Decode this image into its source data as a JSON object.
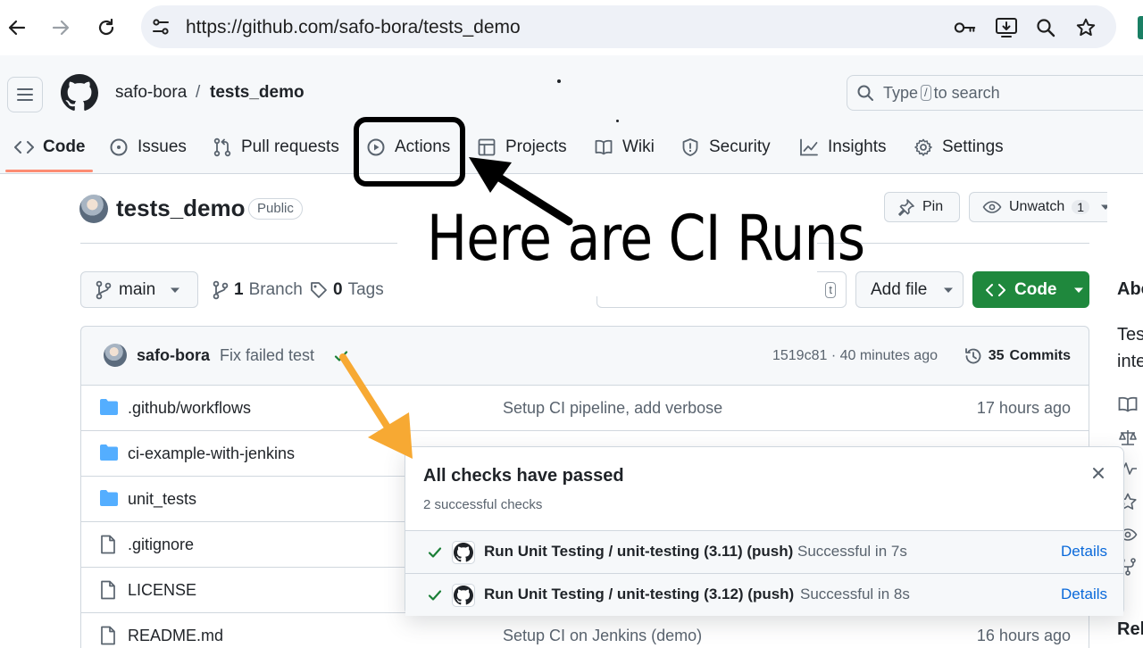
{
  "browser": {
    "url": "https://github.com/safo-bora/tests_demo",
    "icons": [
      "back-arrow-icon",
      "forward-arrow-icon",
      "reload-icon",
      "site-settings-icon",
      "key-icon",
      "install-app-icon",
      "zoom-icon",
      "bookmark-star-icon"
    ]
  },
  "header": {
    "owner": "safo-bora",
    "separator": "/",
    "repo": "tests_demo",
    "search_prefix": "Type",
    "search_key": "/",
    "search_suffix": "to search"
  },
  "tabs": [
    {
      "label": "Code",
      "icon": "code-icon",
      "active": true
    },
    {
      "label": "Issues",
      "icon": "issue-circle-icon"
    },
    {
      "label": "Pull requests",
      "icon": "pull-request-icon"
    },
    {
      "label": "Actions",
      "icon": "play-icon"
    },
    {
      "label": "Projects",
      "icon": "table-icon"
    },
    {
      "label": "Wiki",
      "icon": "book-icon"
    },
    {
      "label": "Security",
      "icon": "shield-icon"
    },
    {
      "label": "Insights",
      "icon": "graph-icon"
    },
    {
      "label": "Settings",
      "icon": "gear-icon"
    }
  ],
  "repo": {
    "name": "tests_demo",
    "visibility": "Public",
    "pin_label": "Pin",
    "unwatch_label": "Unwatch",
    "watch_count": "1"
  },
  "toolbar": {
    "branch": "main",
    "branch_count": "1",
    "branch_label": "Branch",
    "tag_count": "0",
    "tag_label": "Tags",
    "goto_key": "t",
    "add_file": "Add file",
    "code_button": "Code"
  },
  "commit": {
    "author": "safo-bora",
    "message": "Fix failed test",
    "hash_time": "1519c81 · 40 minutes ago",
    "commits_count": "35",
    "commits_label": "Commits"
  },
  "files": [
    {
      "name": ".github/workflows",
      "type": "folder",
      "message": "Setup CI pipeline, add verbose",
      "date": "17 hours ago"
    },
    {
      "name": "ci-example-with-jenkins",
      "type": "folder",
      "message": "",
      "date": ""
    },
    {
      "name": "unit_tests",
      "type": "folder",
      "message": "",
      "date": ""
    },
    {
      "name": ".gitignore",
      "type": "file",
      "message": "",
      "date": ""
    },
    {
      "name": "LICENSE",
      "type": "file",
      "message": "",
      "date": ""
    },
    {
      "name": "README.md",
      "type": "file",
      "message": "Setup CI on Jenkins (demo)",
      "date": "16 hours ago"
    }
  ],
  "checks_popover": {
    "title": "All checks have passed",
    "subtitle": "2 successful checks",
    "checks": [
      {
        "name": "Run Unit Testing / unit-testing (3.11) (push)",
        "status": "Successful in 7s",
        "link": "Details"
      },
      {
        "name": "Run Unit Testing / unit-testing (3.12) (push)",
        "status": "Successful in 8s",
        "link": "Details"
      }
    ]
  },
  "sidebar": {
    "about_fragment": "Abo",
    "desc_line1_fragment": "Tes",
    "desc_line2_fragment": "inte",
    "releases_fragment": "Rel"
  },
  "annotation": {
    "text": "Here are CI Runs"
  },
  "colors": {
    "primary_green": "#1f883d",
    "link_blue": "#0969da",
    "success_green": "#1a7f37",
    "tab_underline": "#fd8c73",
    "arrow_orange": "#f7a933"
  }
}
